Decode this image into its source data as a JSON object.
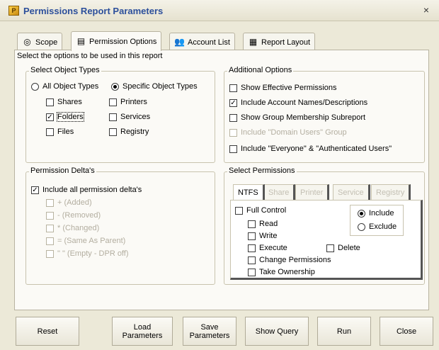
{
  "window": {
    "title": "Permissions Report Parameters",
    "close_glyph": "×",
    "icon": "permissions-app-icon"
  },
  "tabs": [
    {
      "label": "Scope",
      "icon": "scope-icon",
      "active": false
    },
    {
      "label": "Permission Options",
      "icon": "permission-options-icon",
      "active": true
    },
    {
      "label": "Account List",
      "icon": "account-list-icon",
      "active": false
    },
    {
      "label": "Report Layout",
      "icon": "report-layout-icon",
      "active": false
    }
  ],
  "intro_text": "Select the options to be used in this report",
  "object_types": {
    "title": "Select Object Types",
    "all_label": "All Object Types",
    "specific_label": "Specific Object Types",
    "selected": "specific",
    "items": [
      {
        "label": "Shares",
        "checked": false
      },
      {
        "label": "Printers",
        "checked": false
      },
      {
        "label": "Folders",
        "checked": true
      },
      {
        "label": "Services",
        "checked": false
      },
      {
        "label": "Files",
        "checked": false
      },
      {
        "label": "Registry",
        "checked": false
      }
    ]
  },
  "additional_options": {
    "title": "Additional Options",
    "items": [
      {
        "label": "Show Effective Permissions",
        "checked": false,
        "enabled": true
      },
      {
        "label": "Include Account Names/Descriptions",
        "checked": true,
        "enabled": true
      },
      {
        "label": "Show Group Membership Subreport",
        "checked": false,
        "enabled": true
      },
      {
        "label": "Include \"Domain Users\" Group",
        "checked": false,
        "enabled": false
      },
      {
        "label": "Include \"Everyone\" & \"Authenticated Users\"",
        "checked": false,
        "enabled": true
      }
    ]
  },
  "permission_deltas": {
    "title": "Permission Delta's",
    "include_all_label": "Include all permission delta's",
    "include_all_checked": true,
    "items": [
      {
        "label": "+ (Added)"
      },
      {
        "label": "- (Removed)"
      },
      {
        "label": "* (Changed)"
      },
      {
        "label": "= (Same As Parent)"
      },
      {
        "label": "\" \" (Empty - DPR off)"
      }
    ]
  },
  "select_permissions": {
    "title": "Select Permissions",
    "tabs": [
      {
        "label": "NTFS",
        "active": true,
        "enabled": true
      },
      {
        "label": "Share",
        "active": false,
        "enabled": false
      },
      {
        "label": "Printer",
        "active": false,
        "enabled": false
      },
      {
        "label": "Service",
        "active": false,
        "enabled": false
      },
      {
        "label": "Registry",
        "active": false,
        "enabled": false
      }
    ],
    "full_control": "Full Control",
    "read": "Read",
    "write": "Write",
    "execute": "Execute",
    "delete": "Delete",
    "change_permissions": "Change Permissions",
    "take_ownership": "Take Ownership",
    "include_label": "Include",
    "exclude_label": "Exclude",
    "mode": "include"
  },
  "buttons": {
    "reset": "Reset",
    "load_line1": "Load",
    "load_line2": "Parameters",
    "save_line1": "Save",
    "save_line2": "Parameters",
    "show_query": "Show Query",
    "run": "Run",
    "close": "Close"
  }
}
